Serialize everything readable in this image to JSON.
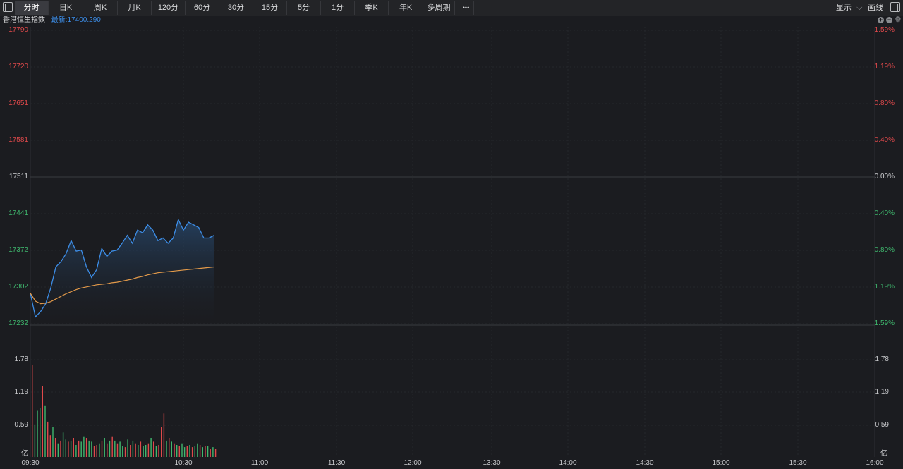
{
  "toolbar": {
    "periods": [
      "分时",
      "日K",
      "周K",
      "月K",
      "120分",
      "60分",
      "30分",
      "15分",
      "5分",
      "1分",
      "季K",
      "年K",
      "多周期"
    ],
    "active": "分时",
    "more": "•••",
    "display_label": "显示",
    "draw_label": "画线"
  },
  "instrument": {
    "name": "香港恒生指数",
    "latest_label": "最新:17400.290"
  },
  "colors": {
    "up": "#e0494b",
    "down": "#3fb86e",
    "neutral": "#d0d1d4",
    "price_line": "#3d8ee8",
    "avg_line": "#e39a4a"
  },
  "price_axis": {
    "prices": [
      "17790",
      "17720",
      "17651",
      "17581",
      "17511",
      "17441",
      "17372",
      "17302",
      "17232"
    ],
    "percents": [
      "1.59%",
      "1.19%",
      "0.80%",
      "0.40%",
      "0.00%",
      "0.40%",
      "0.80%",
      "1.19%",
      "1.59%"
    ],
    "tones": [
      "up",
      "up",
      "up",
      "up",
      "neutral",
      "down",
      "down",
      "down",
      "down"
    ]
  },
  "volume_axis": {
    "values": [
      "1.78",
      "1.19",
      "0.59"
    ],
    "unit": "亿"
  },
  "time_axis": [
    "09:30",
    "10:30",
    "11:00",
    "11:30",
    "12:00",
    "13:30",
    "14:00",
    "14:30",
    "15:00",
    "15:30",
    "16:00"
  ],
  "chart_data": {
    "type": "line",
    "title": "香港恒生指数",
    "ylim": [
      17232,
      17790
    ],
    "prev_close": 17511,
    "x_minutes_from_0930": [
      0,
      2,
      4,
      6,
      8,
      10,
      12,
      14,
      16,
      18,
      20,
      22,
      24,
      26,
      28,
      30,
      32,
      34,
      36,
      38,
      40,
      42,
      44,
      46,
      48,
      50,
      52,
      54,
      56,
      58,
      60,
      62,
      64,
      66,
      68,
      70,
      72
    ],
    "series": [
      {
        "values": [
          17290,
          17245,
          17255,
          17270,
          17300,
          17340,
          17350,
          17365,
          17390,
          17370,
          17372,
          17340,
          17320,
          17335,
          17375,
          17360,
          17370,
          17372,
          17385,
          17400,
          17385,
          17410,
          17405,
          17420,
          17410,
          17390,
          17395,
          17385,
          17395,
          17430,
          17410,
          17425,
          17420,
          17415,
          17395,
          17395,
          17400
        ]
      },
      {
        "values": [
          17290,
          17275,
          17270,
          17271,
          17274,
          17279,
          17284,
          17289,
          17293,
          17297,
          17300,
          17302,
          17304,
          17306,
          17307,
          17308,
          17310,
          17311,
          17313,
          17315,
          17317,
          17320,
          17322,
          17325,
          17327,
          17329,
          17330,
          17331,
          17332,
          17333,
          17334,
          17335,
          17336,
          17337,
          17338,
          17339,
          17340
        ]
      }
    ],
    "volume_unit": "亿",
    "volume_ylim": [
      0,
      2.4
    ],
    "volume": [
      1.7,
      0.6,
      0.85,
      0.9,
      1.3,
      0.95,
      0.65,
      0.4,
      0.55,
      0.35,
      0.25,
      0.3,
      0.45,
      0.32,
      0.28,
      0.3,
      0.35,
      0.22,
      0.3,
      0.28,
      0.38,
      0.35,
      0.3,
      0.28,
      0.2,
      0.22,
      0.25,
      0.3,
      0.35,
      0.25,
      0.3,
      0.38,
      0.3,
      0.25,
      0.28,
      0.2,
      0.18,
      0.32,
      0.22,
      0.3,
      0.25,
      0.22,
      0.28,
      0.2,
      0.22,
      0.25,
      0.35,
      0.28,
      0.2,
      0.22,
      0.55,
      0.8,
      0.3,
      0.35,
      0.28,
      0.25,
      0.22,
      0.2,
      0.25,
      0.18,
      0.2,
      0.22,
      0.18,
      0.2,
      0.25,
      0.22,
      0.18,
      0.2,
      0.2,
      0.15,
      0.18,
      0.15
    ],
    "volume_tone": [
      "up",
      "down",
      "down",
      "down",
      "up",
      "down",
      "up",
      "up",
      "down",
      "up",
      "down",
      "up",
      "down",
      "down",
      "up",
      "down",
      "up",
      "down",
      "up",
      "down",
      "down",
      "up",
      "down",
      "down",
      "up",
      "up",
      "down",
      "up",
      "down",
      "up",
      "down",
      "up",
      "down",
      "up",
      "down",
      "down",
      "up",
      "down",
      "up",
      "down",
      "up",
      "down",
      "up",
      "down",
      "down",
      "up",
      "down",
      "up",
      "down",
      "up",
      "up",
      "up",
      "down",
      "up",
      "down",
      "up",
      "down",
      "up",
      "down",
      "down",
      "up",
      "down",
      "up",
      "down",
      "down",
      "up",
      "down",
      "up",
      "down",
      "up",
      "down",
      "up"
    ]
  }
}
